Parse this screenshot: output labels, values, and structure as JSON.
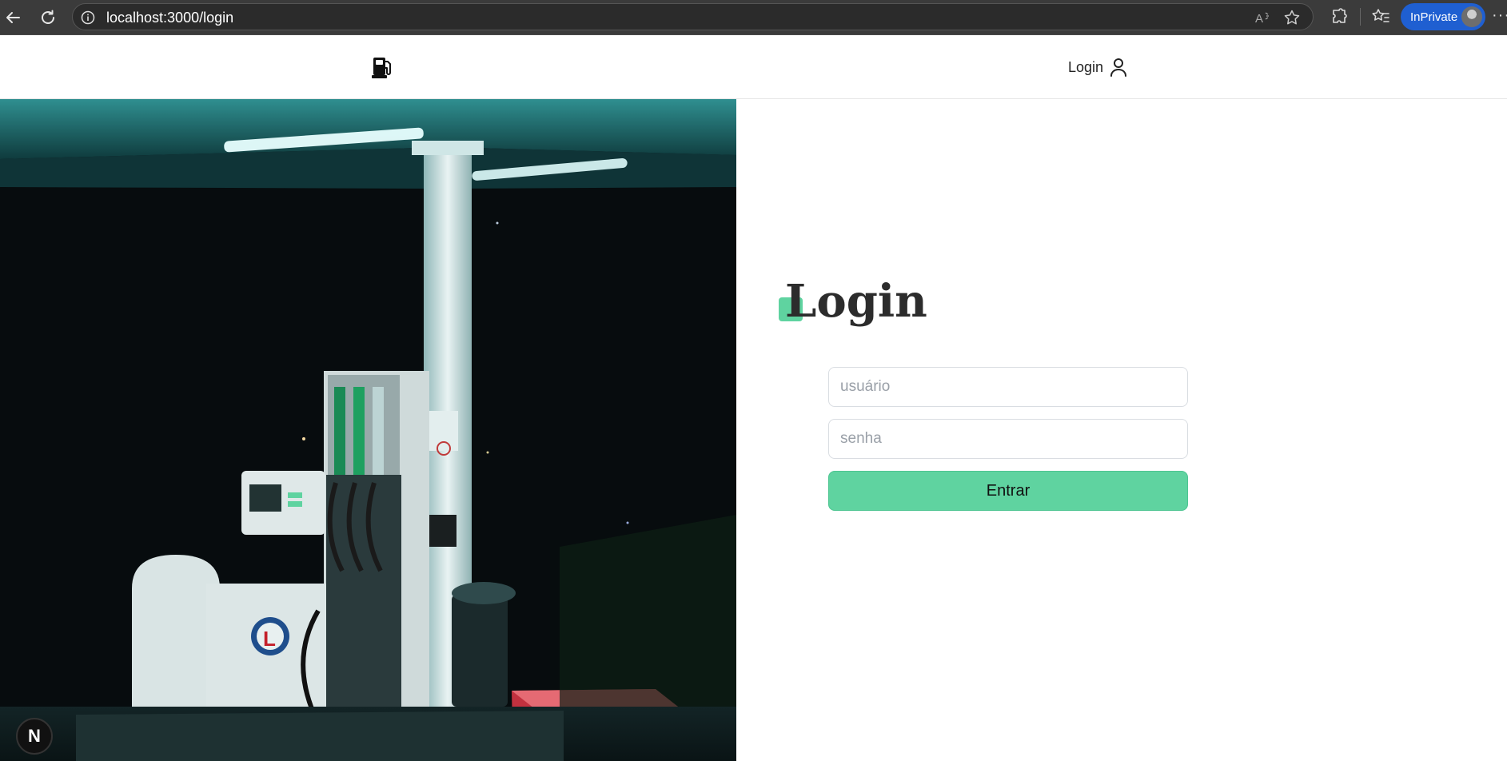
{
  "browser": {
    "url": "localhost:3000/login",
    "private_label": "InPrivate",
    "more_label": "···"
  },
  "header": {
    "brand_icon": "fuel-pump-icon",
    "login_link_label": "Login",
    "login_icon": "user-icon"
  },
  "hero": {
    "image_subject": "gas-station-at-night-photo"
  },
  "login_form": {
    "title": "Login",
    "username_placeholder": "usuário",
    "password_placeholder": "senha",
    "submit_label": "Entrar"
  },
  "next_badge": {
    "label": "N"
  },
  "colors": {
    "accent": "#5fd3a0",
    "browser_bg": "#3b3b3b",
    "private_pill": "#1f5fd1"
  }
}
